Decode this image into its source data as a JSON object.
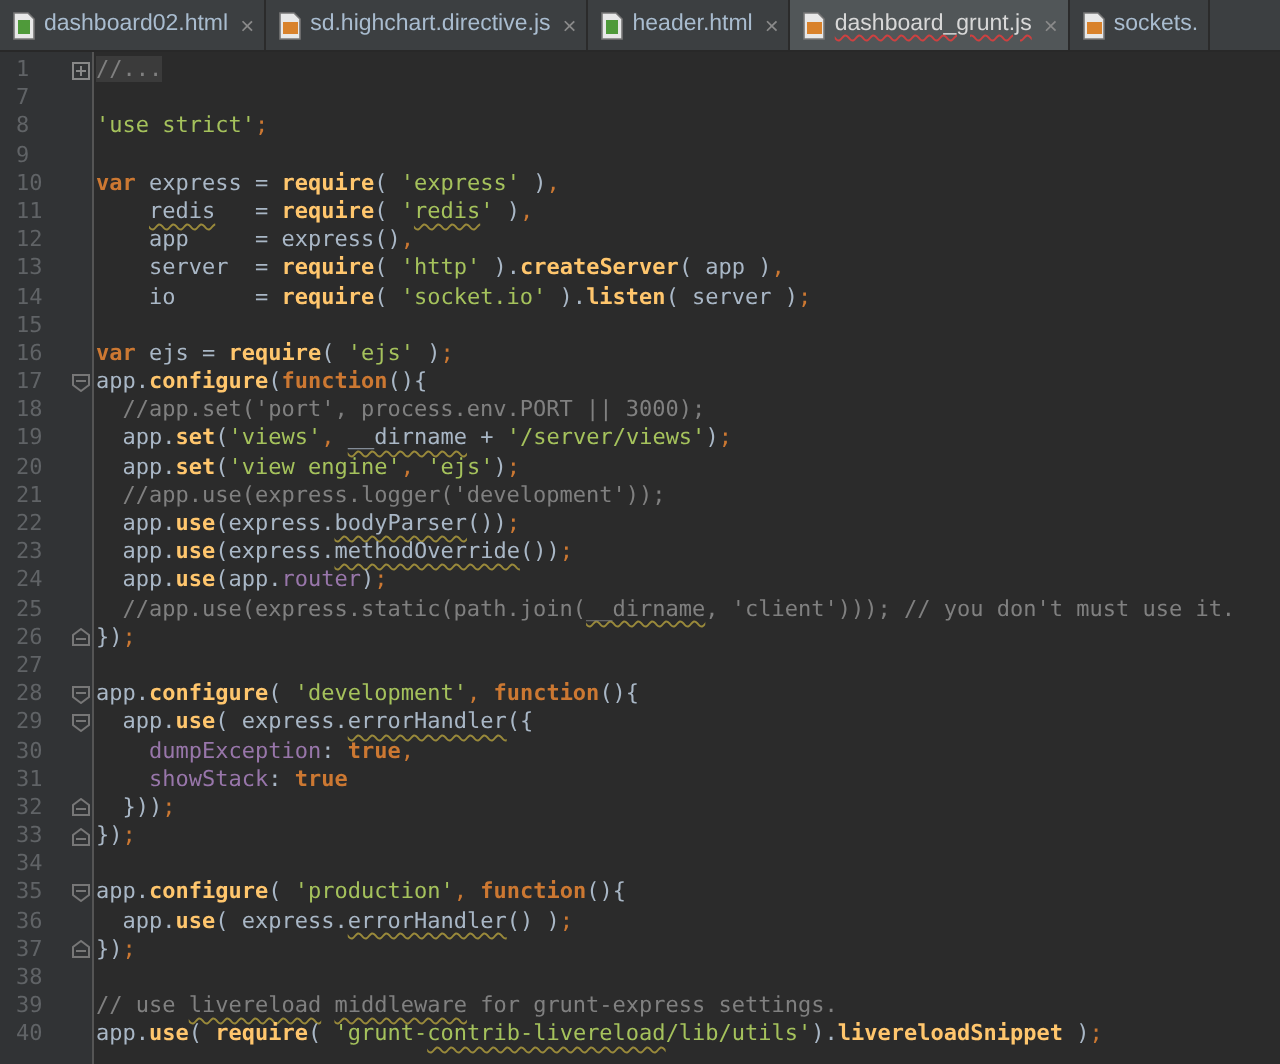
{
  "tabs": [
    {
      "label": "dashboard02.html",
      "kind": "html",
      "selected": false,
      "underlined": false,
      "close": "×"
    },
    {
      "label": "sd.highchart.directive.js",
      "kind": "js",
      "selected": false,
      "underlined": false,
      "close": "×"
    },
    {
      "label": "header.html",
      "kind": "html",
      "selected": false,
      "underlined": false,
      "close": "×"
    },
    {
      "label": "dashboard_grunt.js",
      "kind": "js",
      "selected": true,
      "underlined": true,
      "close": "×"
    },
    {
      "label": "sockets.",
      "kind": "js",
      "selected": false,
      "underlined": false
    }
  ],
  "lines": [
    {
      "number": "1",
      "fold": {
        "kind": "expand"
      },
      "tokens": [
        {
          "kind": "folded",
          "text": "//..."
        }
      ]
    },
    {
      "number": "7"
    },
    {
      "number": "8",
      "tokens": [
        {
          "kind": "string",
          "text": "'use strict'"
        },
        {
          "kind": "punct",
          "text": ";"
        }
      ]
    },
    {
      "number": "9"
    },
    {
      "number": "10",
      "tokens": [
        {
          "kind": "keyword",
          "text": "var"
        },
        {
          "kind": "plain",
          "text": " express = "
        },
        {
          "kind": "call",
          "text": "require"
        },
        {
          "kind": "plain",
          "text": "( "
        },
        {
          "kind": "string",
          "text": "'express'"
        },
        {
          "kind": "plain",
          "text": " )"
        },
        {
          "kind": "punct",
          "text": ","
        }
      ]
    },
    {
      "number": "11",
      "tokens": [
        {
          "kind": "plain",
          "text": "    redis",
          "underlined": true
        },
        {
          "kind": "plain",
          "text": "   = "
        },
        {
          "kind": "call",
          "text": "require"
        },
        {
          "kind": "plain",
          "text": "( "
        },
        {
          "kind": "string",
          "text": "'"
        },
        {
          "kind": "string",
          "text": "redis",
          "underlined": true
        },
        {
          "kind": "string",
          "text": "'"
        },
        {
          "kind": "plain",
          "text": " )"
        },
        {
          "kind": "punct",
          "text": ","
        }
      ]
    },
    {
      "number": "12",
      "tokens": [
        {
          "kind": "plain",
          "text": "    app     = express()"
        },
        {
          "kind": "punct",
          "text": ","
        }
      ]
    },
    {
      "number": "13",
      "tokens": [
        {
          "kind": "plain",
          "text": "    server  = "
        },
        {
          "kind": "call",
          "text": "require"
        },
        {
          "kind": "plain",
          "text": "( "
        },
        {
          "kind": "string",
          "text": "'http'"
        },
        {
          "kind": "plain",
          "text": " )."
        },
        {
          "kind": "call",
          "text": "createServer"
        },
        {
          "kind": "plain",
          "text": "( app )"
        },
        {
          "kind": "punct",
          "text": ","
        }
      ]
    },
    {
      "number": "14",
      "tokens": [
        {
          "kind": "plain",
          "text": "    io      = "
        },
        {
          "kind": "call",
          "text": "require"
        },
        {
          "kind": "plain",
          "text": "( "
        },
        {
          "kind": "string",
          "text": "'socket.io'"
        },
        {
          "kind": "plain",
          "text": " )."
        },
        {
          "kind": "call",
          "text": "listen"
        },
        {
          "kind": "plain",
          "text": "( server )"
        },
        {
          "kind": "punct",
          "text": ";"
        }
      ]
    },
    {
      "number": "15"
    },
    {
      "number": "16",
      "tokens": [
        {
          "kind": "keyword",
          "text": "var"
        },
        {
          "kind": "plain",
          "text": " ejs = "
        },
        {
          "kind": "call",
          "text": "require"
        },
        {
          "kind": "plain",
          "text": "( "
        },
        {
          "kind": "string",
          "text": "'ejs'"
        },
        {
          "kind": "plain",
          "text": " )"
        },
        {
          "kind": "punct",
          "text": ";"
        }
      ]
    },
    {
      "number": "17",
      "fold": {
        "kind": "start"
      },
      "tokens": [
        {
          "kind": "plain",
          "text": "app."
        },
        {
          "kind": "call",
          "text": "configure"
        },
        {
          "kind": "plain",
          "text": "("
        },
        {
          "kind": "keyword",
          "text": "function"
        },
        {
          "kind": "plain",
          "text": "(){"
        }
      ]
    },
    {
      "number": "18",
      "tokens": [
        {
          "kind": "comment",
          "text": "  //app.set('port', process.env.PORT || 3000);"
        }
      ]
    },
    {
      "number": "19",
      "tokens": [
        {
          "kind": "plain",
          "text": "  app."
        },
        {
          "kind": "call",
          "text": "set"
        },
        {
          "kind": "plain",
          "text": "("
        },
        {
          "kind": "string",
          "text": "'views'"
        },
        {
          "kind": "punct",
          "text": ","
        },
        {
          "kind": "plain",
          "text": " __dirname",
          "underlined": true
        },
        {
          "kind": "plain",
          "text": " + "
        },
        {
          "kind": "string",
          "text": "'/server/views'"
        },
        {
          "kind": "plain",
          "text": ")"
        },
        {
          "kind": "punct",
          "text": ";"
        }
      ]
    },
    {
      "number": "20",
      "tokens": [
        {
          "kind": "plain",
          "text": "  app."
        },
        {
          "kind": "call",
          "text": "set"
        },
        {
          "kind": "plain",
          "text": "("
        },
        {
          "kind": "string",
          "text": "'view engine'"
        },
        {
          "kind": "punct",
          "text": ","
        },
        {
          "kind": "string",
          "text": " 'ejs'"
        },
        {
          "kind": "plain",
          "text": ")"
        },
        {
          "kind": "punct",
          "text": ";"
        }
      ]
    },
    {
      "number": "21",
      "tokens": [
        {
          "kind": "comment",
          "text": "  //app.use(express.logger('development'));"
        }
      ]
    },
    {
      "number": "22",
      "tokens": [
        {
          "kind": "plain",
          "text": "  app."
        },
        {
          "kind": "call",
          "text": "use"
        },
        {
          "kind": "plain",
          "text": "(express."
        },
        {
          "kind": "plain",
          "text": "bodyParser",
          "underlined": true
        },
        {
          "kind": "plain",
          "text": "())"
        },
        {
          "kind": "punct",
          "text": ";"
        }
      ]
    },
    {
      "number": "23",
      "tokens": [
        {
          "kind": "plain",
          "text": "  app."
        },
        {
          "kind": "call",
          "text": "use"
        },
        {
          "kind": "plain",
          "text": "(express."
        },
        {
          "kind": "plain",
          "text": "methodOverride",
          "underlined": true
        },
        {
          "kind": "plain",
          "text": "())"
        },
        {
          "kind": "punct",
          "text": ";"
        }
      ]
    },
    {
      "number": "24",
      "tokens": [
        {
          "kind": "plain",
          "text": "  app."
        },
        {
          "kind": "call",
          "text": "use"
        },
        {
          "kind": "plain",
          "text": "(app."
        },
        {
          "kind": "property",
          "text": "router"
        },
        {
          "kind": "plain",
          "text": ")"
        },
        {
          "kind": "punct",
          "text": ";"
        }
      ]
    },
    {
      "number": "25",
      "tokens": [
        {
          "kind": "comment",
          "text": "  //app.use(express.static(path.join("
        },
        {
          "kind": "comment",
          "text": "__dirname",
          "underlined": true
        },
        {
          "kind": "comment",
          "text": ", 'client'))); // you don't must use it."
        }
      ]
    },
    {
      "number": "26",
      "fold": {
        "kind": "end"
      },
      "tokens": [
        {
          "kind": "plain",
          "text": "})"
        },
        {
          "kind": "punct",
          "text": ";"
        }
      ]
    },
    {
      "number": "27"
    },
    {
      "number": "28",
      "fold": {
        "kind": "start"
      },
      "tokens": [
        {
          "kind": "plain",
          "text": "app."
        },
        {
          "kind": "call",
          "text": "configure"
        },
        {
          "kind": "plain",
          "text": "( "
        },
        {
          "kind": "string",
          "text": "'development'"
        },
        {
          "kind": "punct",
          "text": ","
        },
        {
          "kind": "keyword",
          "text": " function"
        },
        {
          "kind": "plain",
          "text": "(){"
        }
      ]
    },
    {
      "number": "29",
      "fold": {
        "kind": "start"
      },
      "tokens": [
        {
          "kind": "plain",
          "text": "  app."
        },
        {
          "kind": "call",
          "text": "use"
        },
        {
          "kind": "plain",
          "text": "( express."
        },
        {
          "kind": "plain",
          "text": "errorHandler",
          "underlined": true
        },
        {
          "kind": "plain",
          "text": "({"
        }
      ]
    },
    {
      "number": "30",
      "tokens": [
        {
          "kind": "property",
          "text": "    dumpException"
        },
        {
          "kind": "plain",
          "text": ": "
        },
        {
          "kind": "keyword",
          "text": "true"
        },
        {
          "kind": "punct",
          "text": ","
        }
      ]
    },
    {
      "number": "31",
      "tokens": [
        {
          "kind": "property",
          "text": "    showStack"
        },
        {
          "kind": "plain",
          "text": ": "
        },
        {
          "kind": "keyword",
          "text": "true"
        }
      ]
    },
    {
      "number": "32",
      "fold": {
        "kind": "end"
      },
      "tokens": [
        {
          "kind": "plain",
          "text": "  }))"
        },
        {
          "kind": "punct",
          "text": ";"
        }
      ]
    },
    {
      "number": "33",
      "fold": {
        "kind": "end"
      },
      "tokens": [
        {
          "kind": "plain",
          "text": "})"
        },
        {
          "kind": "punct",
          "text": ";"
        }
      ]
    },
    {
      "number": "34"
    },
    {
      "number": "35",
      "fold": {
        "kind": "start"
      },
      "tokens": [
        {
          "kind": "plain",
          "text": "app."
        },
        {
          "kind": "call",
          "text": "configure"
        },
        {
          "kind": "plain",
          "text": "( "
        },
        {
          "kind": "string",
          "text": "'production'"
        },
        {
          "kind": "punct",
          "text": ","
        },
        {
          "kind": "keyword",
          "text": " function"
        },
        {
          "kind": "plain",
          "text": "(){"
        }
      ]
    },
    {
      "number": "36",
      "tokens": [
        {
          "kind": "plain",
          "text": "  app."
        },
        {
          "kind": "call",
          "text": "use"
        },
        {
          "kind": "plain",
          "text": "( express."
        },
        {
          "kind": "plain",
          "text": "errorHandler",
          "underlined": true
        },
        {
          "kind": "plain",
          "text": "() )"
        },
        {
          "kind": "punct",
          "text": ";"
        }
      ]
    },
    {
      "number": "37",
      "fold": {
        "kind": "end"
      },
      "tokens": [
        {
          "kind": "plain",
          "text": "})"
        },
        {
          "kind": "punct",
          "text": ";"
        }
      ]
    },
    {
      "number": "38"
    },
    {
      "number": "39",
      "tokens": [
        {
          "kind": "comment",
          "text": "// use "
        },
        {
          "kind": "comment",
          "text": "livereload",
          "underlined": true
        },
        {
          "kind": "comment",
          "text": " middleware",
          "underlined": true
        },
        {
          "kind": "comment",
          "text": " for grunt-express settings."
        }
      ]
    },
    {
      "number": "40",
      "tokens": [
        {
          "kind": "plain",
          "text": "app."
        },
        {
          "kind": "call",
          "text": "use"
        },
        {
          "kind": "plain",
          "text": "( "
        },
        {
          "kind": "call",
          "text": "require"
        },
        {
          "kind": "plain",
          "text": "( "
        },
        {
          "kind": "string",
          "text": "'grunt-"
        },
        {
          "kind": "string",
          "text": "contrib-livereload",
          "underlined": true
        },
        {
          "kind": "string",
          "text": "/lib/utils'"
        },
        {
          "kind": "plain",
          "text": ")."
        },
        {
          "kind": "call",
          "text": "livereloadSnippet"
        },
        {
          "kind": "plain",
          "text": " )"
        },
        {
          "kind": "punct",
          "text": ";"
        }
      ]
    }
  ]
}
